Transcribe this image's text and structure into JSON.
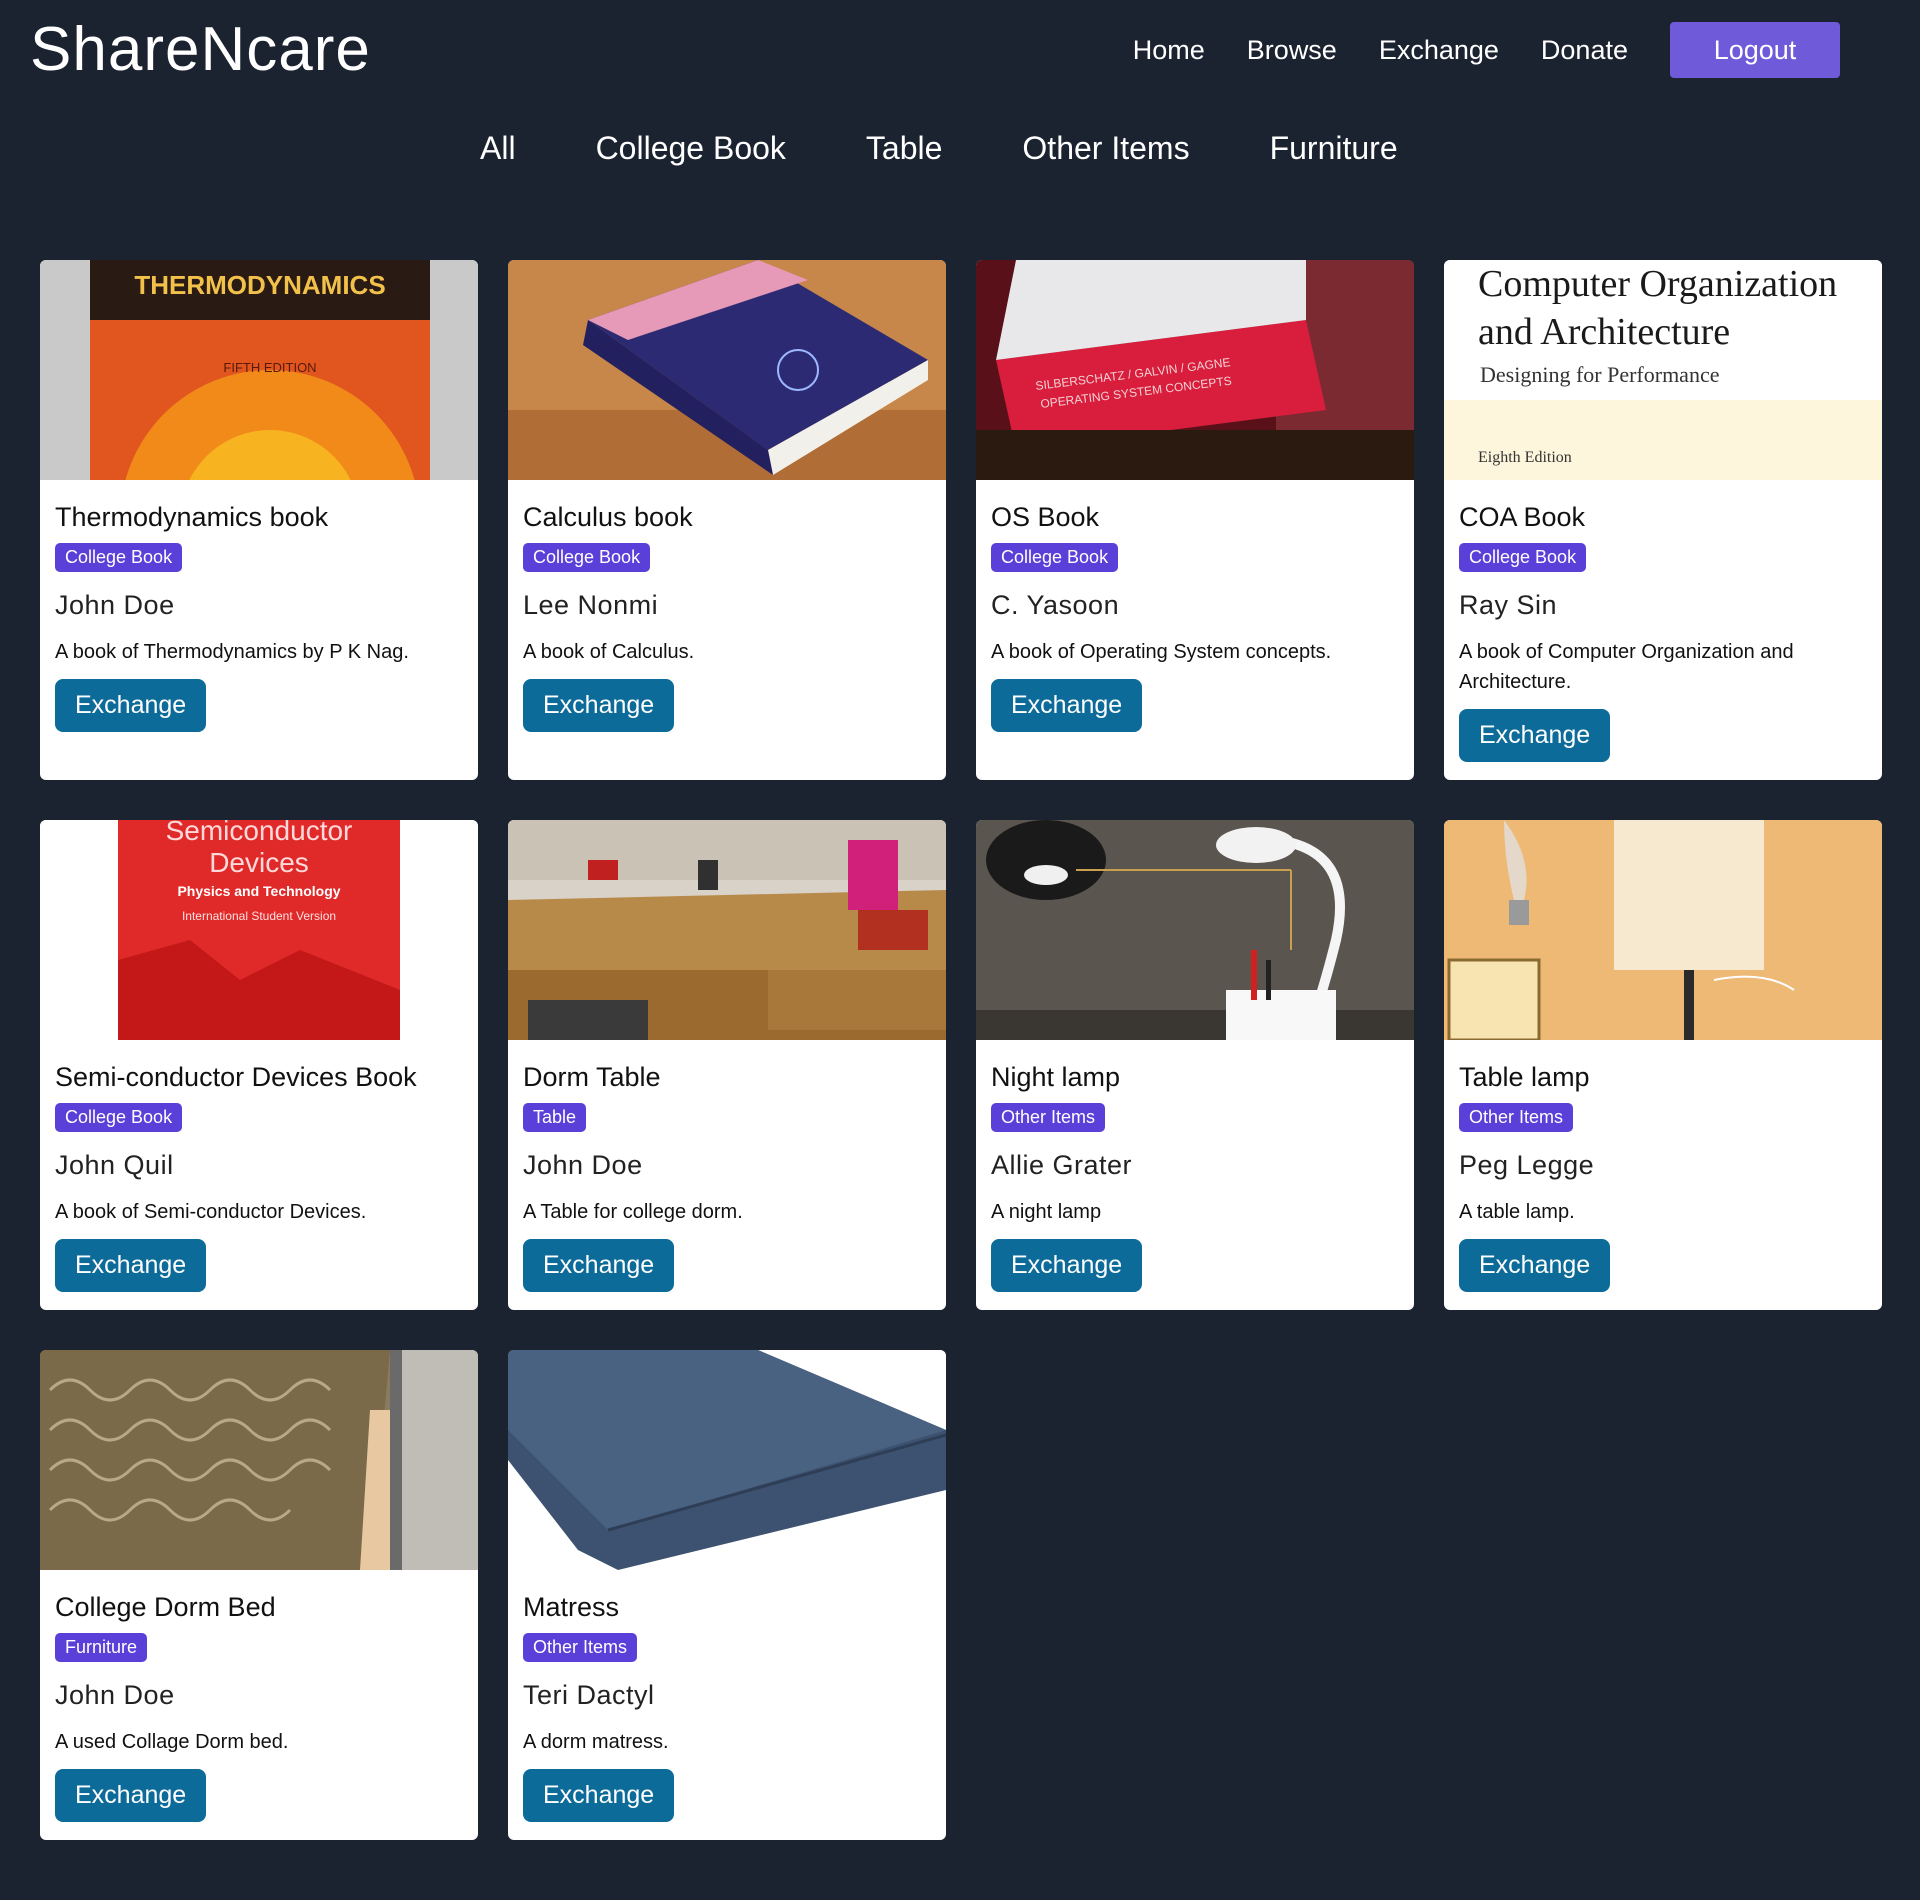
{
  "brand": "ShareNcare",
  "nav": {
    "home": "Home",
    "browse": "Browse",
    "exchange": "Exchange",
    "donate": "Donate",
    "logout": "Logout"
  },
  "filters": [
    "All",
    "College Book",
    "Table",
    "Other Items",
    "Furniture"
  ],
  "items": [
    {
      "title": "Thermodynamics book",
      "category": "College Book",
      "owner": "John Doe",
      "description": "A book of Thermodynamics by P K Nag.",
      "action": "Exchange",
      "image_cover_text": [
        "THERMODYNAMICS",
        "FIFTH EDITION"
      ]
    },
    {
      "title": "Calculus book",
      "category": "College Book",
      "owner": "Lee Nonmi",
      "description": "A book of Calculus.",
      "action": "Exchange"
    },
    {
      "title": "OS Book",
      "category": "College Book",
      "owner": "C. Yasoon",
      "description": "A book of Operating System concepts.",
      "action": "Exchange",
      "image_cover_text": [
        "SILBERSCHATZ / GALVIN / GAGNE",
        "OPERATING SYSTEM CONCEPTS"
      ]
    },
    {
      "title": "COA Book",
      "category": "College Book",
      "owner": "Ray Sin",
      "description": "A book of Computer Organization and Architecture.",
      "action": "Exchange",
      "image_cover_text": [
        "Computer Organization",
        "and Architecture",
        "Designing for Performance",
        "Eighth Edition"
      ]
    },
    {
      "title": "Semi-conductor Devices Book",
      "category": "College Book",
      "owner": "John Quil",
      "description": "A book of Semi-conductor Devices.",
      "action": "Exchange",
      "image_cover_text": [
        "Semiconductor",
        "Devices",
        "Physics and Technology",
        "International Student Version"
      ]
    },
    {
      "title": "Dorm Table",
      "category": "Table",
      "owner": "John Doe",
      "description": "A Table for college dorm.",
      "action": "Exchange"
    },
    {
      "title": "Night lamp",
      "category": "Other Items",
      "owner": "Allie Grater",
      "description": "A night lamp",
      "action": "Exchange"
    },
    {
      "title": "Table lamp",
      "category": "Other Items",
      "owner": "Peg Legge",
      "description": "A table lamp.",
      "action": "Exchange"
    },
    {
      "title": "College Dorm Bed",
      "category": "Furniture",
      "owner": "John Doe",
      "description": "A used Collage Dorm bed.",
      "action": "Exchange"
    },
    {
      "title": "Matress",
      "category": "Other Items",
      "owner": "Teri Dactyl",
      "description": "A dorm matress.",
      "action": "Exchange"
    }
  ],
  "colors": {
    "background": "#1b2230",
    "logout_button": "#6f5ad9",
    "badge": "#5a3fd8",
    "exchange_button": "#0d6b99"
  }
}
